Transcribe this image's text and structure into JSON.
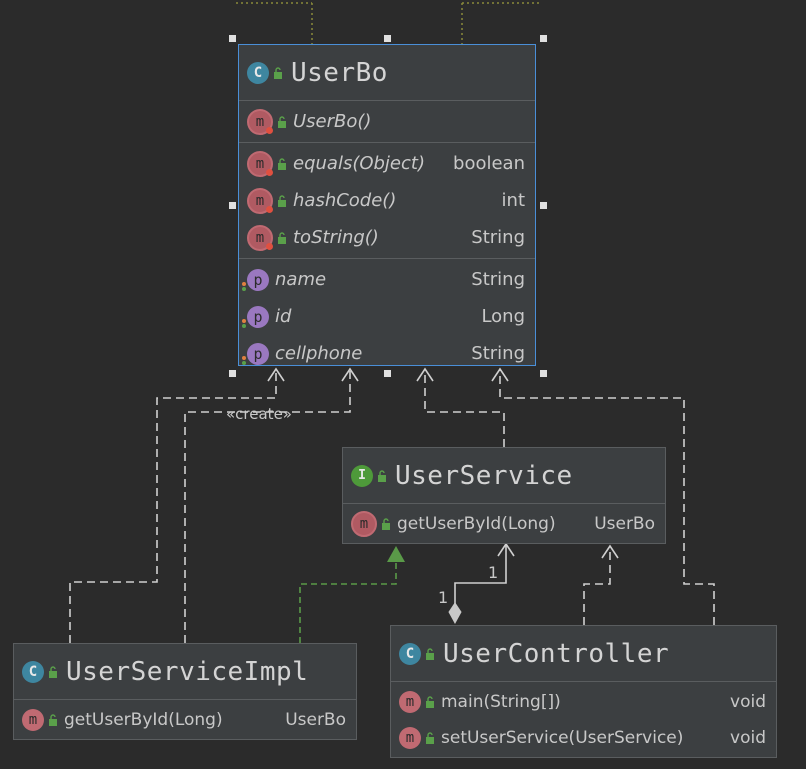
{
  "diagram": {
    "classes": {
      "userbo": {
        "name": "UserBo",
        "constructor": "UserBo()",
        "methods": [
          {
            "name": "equals(Object)",
            "type": "boolean"
          },
          {
            "name": "hashCode()",
            "type": "int"
          },
          {
            "name": "toString()",
            "type": "String"
          }
        ],
        "properties": [
          {
            "name": "name",
            "type": "String"
          },
          {
            "name": "id",
            "type": "Long"
          },
          {
            "name": "cellphone",
            "type": "String"
          }
        ]
      },
      "userservice": {
        "name": "UserService",
        "methods": [
          {
            "name": "getUserById(Long)",
            "type": "UserBo"
          }
        ]
      },
      "userserviceimpl": {
        "name": "UserServiceImpl",
        "methods": [
          {
            "name": "getUserById(Long)",
            "type": "UserBo"
          }
        ]
      },
      "usercontroller": {
        "name": "UserController",
        "methods": [
          {
            "name": "main(String[])",
            "type": "void"
          },
          {
            "name": "setUserService(UserService)",
            "type": "void"
          }
        ]
      }
    },
    "labels": {
      "create": "«create»",
      "mult_target": "1",
      "mult_source": "1"
    },
    "icons": {
      "class": "C",
      "interface": "I",
      "method": "m",
      "property": "p"
    },
    "colors": {
      "background": "#2b2b2b",
      "box": "#3c3f41",
      "selection": "#4a8fd8",
      "dependency_line": "#d0d0d0",
      "implementation_line": "#5a9a48"
    }
  }
}
